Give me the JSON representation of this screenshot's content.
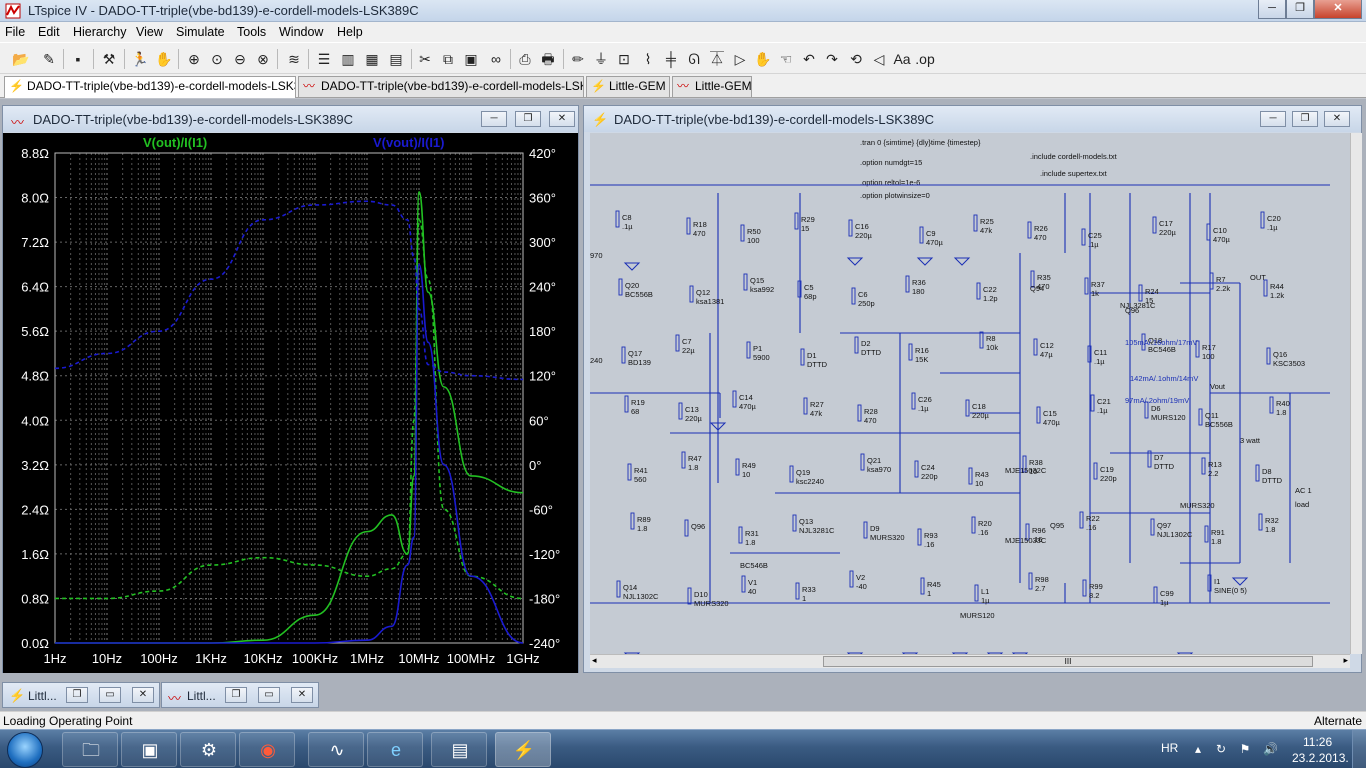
{
  "window": {
    "app_title": "LTspice IV - DADO-TT-triple(vbe-bd139)-e-cordell-models-LSK389C",
    "min": "─",
    "max": "❐",
    "close": "✕"
  },
  "menu": [
    "File",
    "Edit",
    "Hierarchy",
    "View",
    "Simulate",
    "Tools",
    "Window",
    "Help"
  ],
  "toolbar_icons": [
    "open-icon",
    "new-schematic-icon",
    "save-icon",
    "control-panel-icon",
    "run-icon",
    "halt-icon",
    "zoom-in-icon",
    "zoom-full-icon",
    "zoom-out-icon",
    "zoom-fit-icon",
    "autorange-icon",
    "tile-horizontal-icon",
    "tile-vertical-icon",
    "cascade-icon",
    "cut-icon",
    "copy-icon",
    "find-icon",
    "binoculars-icon",
    "print-preview-icon",
    "print-icon",
    "pencil-icon",
    "ground-icon",
    "label-icon",
    "resistor-icon",
    "capacitor-icon",
    "inductor-icon",
    "diode-icon",
    "component-icon",
    "move-icon",
    "drag-icon",
    "undo-icon",
    "redo-icon",
    "rotate-icon",
    "mirror-icon",
    "text-icon",
    "spice-directive-icon"
  ],
  "tabs": [
    {
      "label": "DADO-TT-triple(vbe-bd139)-e-cordell-models-LSK389C",
      "icon": "schematic-tab-icon",
      "active": true
    },
    {
      "label": "DADO-TT-triple(vbe-bd139)-e-cordell-models-LSK389C",
      "icon": "waveform-tab-icon",
      "active": false
    },
    {
      "label": "Little-GEM",
      "icon": "schematic-tab-icon",
      "active": false
    },
    {
      "label": "Little-GEM",
      "icon": "waveform-tab-icon",
      "active": false
    }
  ],
  "plot_window": {
    "title": "DADO-TT-triple(vbe-bd139)-e-cordell-models-LSK389C",
    "min": "─",
    "max": "❐",
    "close": "✕"
  },
  "schematic_window": {
    "title": "DADO-TT-triple(vbe-bd139)-e-cordell-models-LSK389C",
    "min": "─",
    "max": "❐",
    "close": "✕",
    "scroll_grip": "III",
    "directives": [
      ".tran 0 {simtime} {dly}time {timestep}",
      ".option numdgt=15",
      ".option reltol=1e-6",
      ".option plotwinsize=0",
      ".include cordell-models.txt",
      ".include supertex.txt"
    ],
    "components": [
      {
        "ref": "C8",
        "val": ".1µ"
      },
      {
        "ref": "R18",
        "val": "470"
      },
      {
        "ref": "R50",
        "val": "100"
      },
      {
        "ref": "R29",
        "val": "15"
      },
      {
        "ref": "C16",
        "val": "220µ"
      },
      {
        "ref": "C9",
        "val": "470µ"
      },
      {
        "ref": "R25",
        "val": "47k"
      },
      {
        "ref": "R26",
        "val": "470"
      },
      {
        "ref": "C25",
        "val": ".1µ"
      },
      {
        "ref": "C17",
        "val": "220µ"
      },
      {
        "ref": "C10",
        "val": "470µ"
      },
      {
        "ref": "C20",
        "val": ".1µ"
      },
      {
        "ref": "Q20",
        "val": "BC556B"
      },
      {
        "ref": "Q12",
        "val": "ksa1381"
      },
      {
        "ref": "Q15",
        "val": "ksa992"
      },
      {
        "ref": "C5",
        "val": "68p"
      },
      {
        "ref": "C6",
        "val": "250p"
      },
      {
        "ref": "R36",
        "val": "180"
      },
      {
        "ref": "C22",
        "val": "1.2p"
      },
      {
        "ref": "R35",
        "val": "470"
      },
      {
        "ref": "R37",
        "val": "1k"
      },
      {
        "ref": "R24",
        "val": "15"
      },
      {
        "ref": "R7",
        "val": "2.2k"
      },
      {
        "ref": "R44",
        "val": "1.2k"
      },
      {
        "ref": "Q17",
        "val": "BD139"
      },
      {
        "ref": "C7",
        "val": "22µ"
      },
      {
        "ref": "P1",
        "val": "5900"
      },
      {
        "ref": "D1",
        "val": "DTTD"
      },
      {
        "ref": "D2",
        "val": "DTTD"
      },
      {
        "ref": "R16",
        "val": "15K"
      },
      {
        "ref": "R8",
        "val": "10k"
      },
      {
        "ref": "C12",
        "val": "47µ"
      },
      {
        "ref": "C11",
        "val": ".1µ"
      },
      {
        "ref": "Q18",
        "val": "BC546B"
      },
      {
        "ref": "R17",
        "val": "100"
      },
      {
        "ref": "Q16",
        "val": "KSC3503"
      },
      {
        "ref": "R19",
        "val": "68"
      },
      {
        "ref": "C13",
        "val": "220µ"
      },
      {
        "ref": "C14",
        "val": "470µ"
      },
      {
        "ref": "R27",
        "val": "47k"
      },
      {
        "ref": "R28",
        "val": "470"
      },
      {
        "ref": "C26",
        "val": ".1µ"
      },
      {
        "ref": "C18",
        "val": "220µ"
      },
      {
        "ref": "C15",
        "val": "470µ"
      },
      {
        "ref": "C21",
        "val": ".1µ"
      },
      {
        "ref": "D6",
        "val": "MURS120"
      },
      {
        "ref": "Q11",
        "val": "BC556B"
      },
      {
        "ref": "R40",
        "val": "1.8"
      },
      {
        "ref": "R41",
        "val": "560"
      },
      {
        "ref": "R47",
        "val": "1.8"
      },
      {
        "ref": "R49",
        "val": "10"
      },
      {
        "ref": "Q19",
        "val": "ksc2240"
      },
      {
        "ref": "Q21",
        "val": "ksa970"
      },
      {
        "ref": "C24",
        "val": "220p"
      },
      {
        "ref": "R43",
        "val": "10"
      },
      {
        "ref": "R38",
        "val": "10"
      },
      {
        "ref": "C19",
        "val": "220p"
      },
      {
        "ref": "D7",
        "val": "DTTD"
      },
      {
        "ref": "R13",
        "val": "2.2"
      },
      {
        "ref": "D8",
        "val": "DTTD"
      },
      {
        "ref": "R89",
        "val": "1.8"
      },
      {
        "ref": "Q96",
        "val": ""
      },
      {
        "ref": "R31",
        "val": "1.8"
      },
      {
        "ref": "Q13",
        "val": "NJL3281C"
      },
      {
        "ref": "D9",
        "val": "MURS320"
      },
      {
        "ref": "R93",
        "val": ".16"
      },
      {
        "ref": "R20",
        "val": ".16"
      },
      {
        "ref": "R96",
        "val": ".16"
      },
      {
        "ref": "R22",
        "val": ".16"
      },
      {
        "ref": "Q97",
        "val": "NJL1302C"
      },
      {
        "ref": "R91",
        "val": "1.8"
      },
      {
        "ref": "R32",
        "val": "1.8"
      },
      {
        "ref": "Q14",
        "val": "NJL1302C"
      },
      {
        "ref": "D10",
        "val": "MURS320"
      },
      {
        "ref": "V1",
        "val": "40"
      },
      {
        "ref": "R33",
        "val": "1"
      },
      {
        "ref": "V2",
        "val": "-40"
      },
      {
        "ref": "R45",
        "val": "1"
      },
      {
        "ref": "L1",
        "val": "1µ"
      },
      {
        "ref": "R98",
        "val": "2.7"
      },
      {
        "ref": "R99",
        "val": "8.2"
      },
      {
        "ref": "C99",
        "val": "1µ"
      },
      {
        "ref": "I1",
        "val": "SINE(0 5)"
      }
    ],
    "annotations": [
      "105mA/.16ohm/17mV",
      "142mA/.1ohm/14mV",
      "97mA/.2ohm/19mV",
      "3 watt",
      "AC 1",
      "load",
      "OUT",
      "Vout",
      "MJE15032C",
      "MJE15033C",
      "NJL3281C",
      "MURS320",
      "MURS120",
      "BC546B",
      "970",
      "240",
      "Q96",
      "Q94",
      "Q95"
    ]
  },
  "chart_data": {
    "type": "line",
    "title": "",
    "xlabel": "",
    "ylabel": "",
    "x": [
      1,
      10,
      100,
      1000,
      10000,
      100000,
      1000000,
      3000000,
      6000000,
      8000000,
      10000000,
      15000000,
      30000000,
      100000000,
      1000000000
    ],
    "x_ticks": [
      "1Hz",
      "10Hz",
      "100Hz",
      "1KHz",
      "10KHz",
      "100KHz",
      "1MHz",
      "10MHz",
      "100MHz",
      "1GHz"
    ],
    "y_left_ticks": [
      "8.8Ω",
      "8.0Ω",
      "7.2Ω",
      "6.4Ω",
      "5.6Ω",
      "4.8Ω",
      "4.0Ω",
      "3.2Ω",
      "2.4Ω",
      "1.6Ω",
      "0.8Ω",
      "0.0Ω"
    ],
    "y_right_ticks": [
      "420°",
      "360°",
      "300°",
      "240°",
      "180°",
      "120°",
      "60°",
      "0°",
      "-60°",
      "-120°",
      "-180°",
      "-240°"
    ],
    "ylim_left": [
      0,
      8.8
    ],
    "ylim_right": [
      -240,
      420
    ],
    "x_scale": "log",
    "grid": true,
    "legend": "top",
    "series": [
      {
        "name": "V(out)/I(I1)",
        "color": "#22c022",
        "style": "solid",
        "axis": "left",
        "values": [
          0.0,
          0.0,
          0.0,
          0.0,
          0.05,
          0.5,
          2.0,
          2.3,
          1.6,
          3.0,
          8.1,
          6.3,
          4.6,
          3.0,
          2.7
        ]
      },
      {
        "name": "V(out)/I(I1)",
        "color": "#22c022",
        "style": "dashed",
        "axis": "right",
        "values": [
          -180,
          -180,
          -170,
          -135,
          -125,
          -135,
          -150,
          -140,
          -120,
          60,
          330,
          250,
          -60,
          -150,
          -180
        ]
      },
      {
        "name": "V(vout)/I(I1)",
        "color": "#1a1ad0",
        "style": "solid",
        "axis": "left",
        "values": [
          0.0,
          0.0,
          0.0,
          0.0,
          0.0,
          0.0,
          0.05,
          0.3,
          1.4,
          1.9,
          6.8,
          5.4,
          3.2,
          1.2,
          0.0
        ]
      },
      {
        "name": "V(vout)/I(I1)",
        "color": "#1a1ad0",
        "style": "dashed",
        "axis": "right",
        "values": [
          130,
          150,
          180,
          250,
          330,
          350,
          355,
          350,
          330,
          280,
          210,
          135,
          125,
          120,
          115
        ]
      }
    ]
  },
  "minimized_windows": [
    {
      "label": "Littl...",
      "icon": "schematic-tab-icon"
    },
    {
      "label": "Littl...",
      "icon": "waveform-tab-icon"
    }
  ],
  "status": {
    "left": "Loading Operating Point",
    "right": "Alternate"
  },
  "taskbar": {
    "apps": [
      "explorer-icon",
      "package-icon",
      "tool-icon",
      "ccleaner-icon",
      "scope-icon",
      "internet-explorer-icon",
      "control-panel-icon",
      "ltspice-icon"
    ],
    "lang": "HR",
    "time": "11:26",
    "date": "23.2.2013."
  }
}
